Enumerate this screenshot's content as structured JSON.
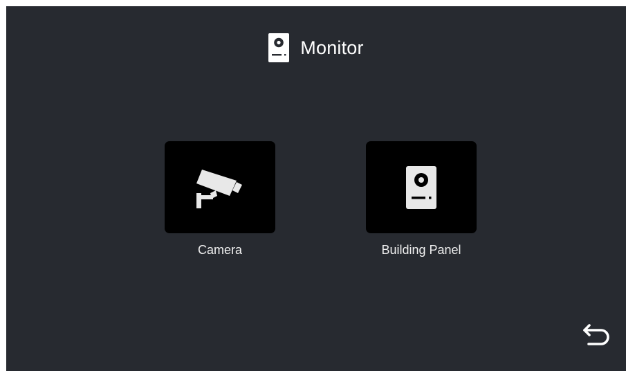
{
  "header": {
    "title": "Monitor",
    "icon": "building-panel-icon"
  },
  "tiles": [
    {
      "label": "Camera",
      "icon": "cctv-camera-icon"
    },
    {
      "label": "Building Panel",
      "icon": "building-panel-icon"
    }
  ],
  "back": {
    "icon": "back-arrow-icon"
  },
  "colors": {
    "background": "#272a30",
    "tile": "#000000",
    "icon": "#e8e8e8",
    "text": "#ffffff"
  }
}
